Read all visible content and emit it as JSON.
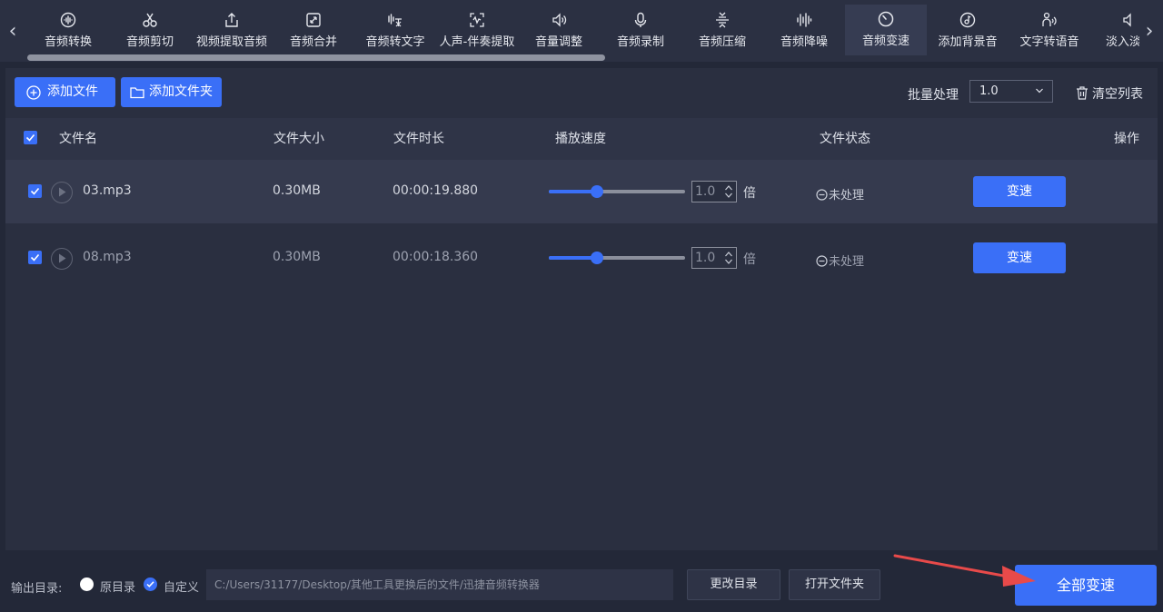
{
  "toolbar": {
    "nav_prev": "‹",
    "nav_next": "›",
    "tools": [
      {
        "label": "音频转换",
        "icon": "audio-wave-circle-icon"
      },
      {
        "label": "音频剪切",
        "icon": "scissors-icon"
      },
      {
        "label": "视频提取音频",
        "icon": "upload-box-icon"
      },
      {
        "label": "音频合并",
        "icon": "merge-box-icon"
      },
      {
        "label": "音频转文字",
        "icon": "audio-text-icon"
      },
      {
        "label": "人声-伴奏提取",
        "icon": "vocal-extract-icon"
      },
      {
        "label": "音量调整",
        "icon": "volume-icon"
      },
      {
        "label": "音频录制",
        "icon": "microphone-icon"
      },
      {
        "label": "音频压缩",
        "icon": "compress-icon"
      },
      {
        "label": "音频降噪",
        "icon": "noise-reduce-icon"
      },
      {
        "label": "音频变速",
        "icon": "speed-clock-icon"
      },
      {
        "label": "添加背景音",
        "icon": "music-note-icon"
      },
      {
        "label": "文字转语音",
        "icon": "text-speech-icon"
      },
      {
        "label": "淡入淡",
        "icon": "fade-icon"
      }
    ],
    "active_tool": "音频变速"
  },
  "actions": {
    "add_file": "添加文件",
    "add_folder": "添加文件夹",
    "batch_label": "批量处理",
    "batch_value": "1.0",
    "clear_list": "清空列表"
  },
  "table": {
    "headers": {
      "name": "文件名",
      "size": "文件大小",
      "duration": "文件时长",
      "speed": "播放速度",
      "status": "文件状态",
      "operation": "操作"
    },
    "rows": [
      {
        "name": "03.mp3",
        "size": "0.30MB",
        "duration": "00:00:19.880",
        "speed_value": "1.0",
        "speed_unit": "倍",
        "slider_fraction": 0.35,
        "status": "未处理",
        "action": "变速",
        "checked": true
      },
      {
        "name": "08.mp3",
        "size": "0.30MB",
        "duration": "00:00:18.360",
        "speed_value": "1.0",
        "speed_unit": "倍",
        "slider_fraction": 0.35,
        "status": "未处理",
        "action": "变速",
        "checked": true
      }
    ]
  },
  "output": {
    "label": "输出目录:",
    "option_original": "原目录",
    "option_custom": "自定义",
    "selected": "自定义",
    "path": "C:/Users/31177/Desktop/其他工具更换后的文件/迅捷音频转换器",
    "change_dir": "更改目录",
    "open_folder": "打开文件夹",
    "convert_all": "全部变速"
  },
  "colors": {
    "accent": "#3a6ff7",
    "annotation_arrow": "#e84a4a",
    "background": "#232838",
    "panel": "#2a2f40"
  }
}
